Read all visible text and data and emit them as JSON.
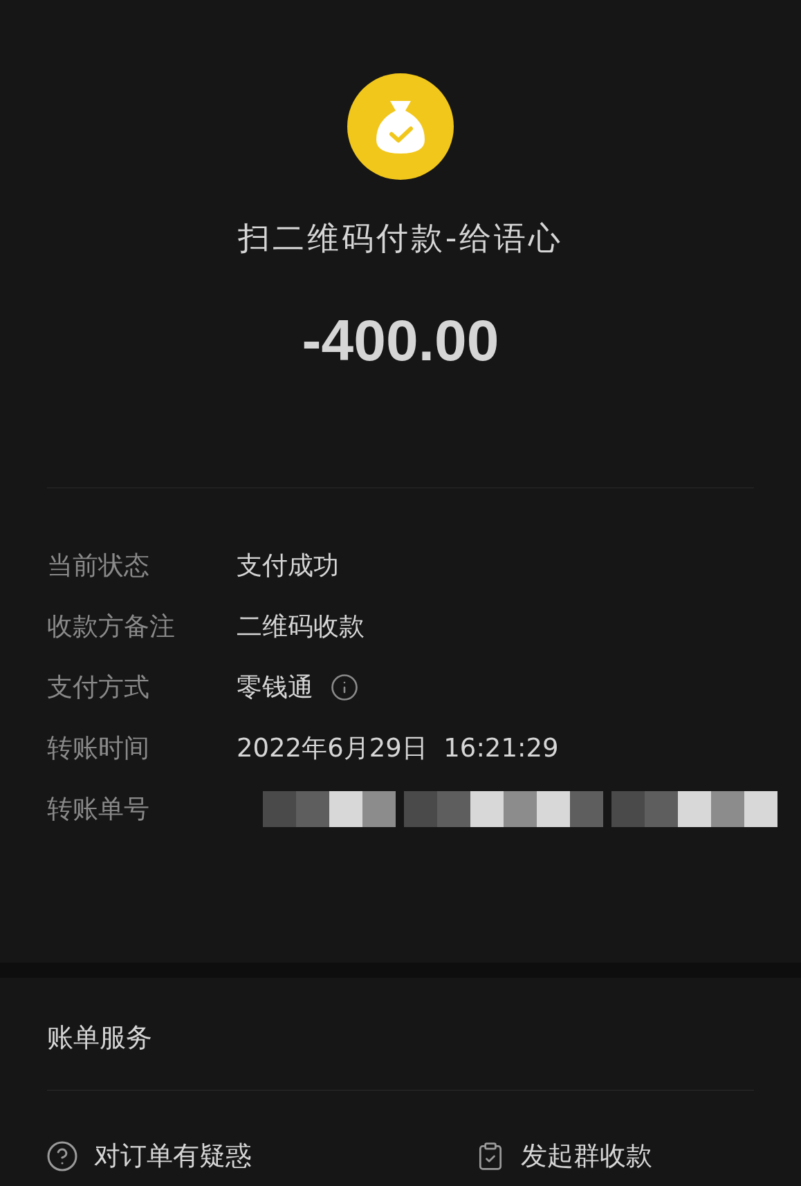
{
  "header": {
    "title": "扫二维码付款-给语心",
    "amount": "-400.00"
  },
  "details": [
    {
      "label": "当前状态",
      "value": "支付成功",
      "kind": "text"
    },
    {
      "label": "收款方备注",
      "value": "二维码收款",
      "kind": "text"
    },
    {
      "label": "支付方式",
      "value": "零钱通",
      "kind": "info"
    },
    {
      "label": "转账时间",
      "value": "2022年6月29日  16:21:29",
      "kind": "text"
    },
    {
      "label": "转账单号",
      "kind": "redacted"
    }
  ],
  "services": {
    "title": "账单服务",
    "actions": [
      {
        "label": "对订单有疑惑",
        "kind": "help"
      },
      {
        "label": "发起群收款",
        "kind": "receipt"
      }
    ]
  }
}
